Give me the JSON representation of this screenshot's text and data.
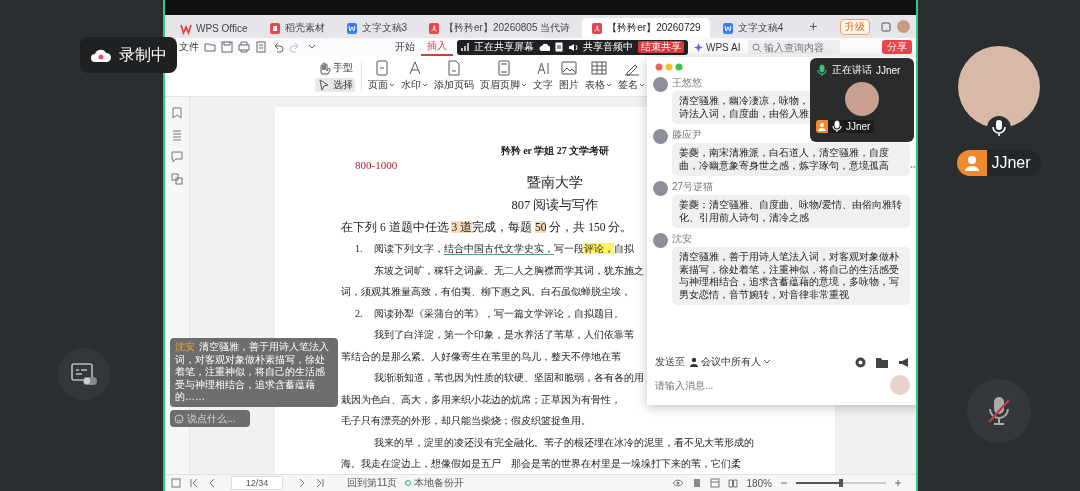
{
  "recording": {
    "label": "录制中"
  },
  "tabs": [
    {
      "label": "WPS Office",
      "kind": "wps",
      "selected": false
    },
    {
      "label": "稻壳素材",
      "kind": "docer",
      "selected": false
    },
    {
      "label": "文字文稿3",
      "kind": "doc",
      "selected": false
    },
    {
      "label": "【矜矜er】20260805 当代诗",
      "kind": "pdf",
      "selected": false
    },
    {
      "label": "【矜矜er】20260729",
      "kind": "pdf",
      "selected": true
    },
    {
      "label": "文字文稿4",
      "kind": "doc",
      "selected": false
    }
  ],
  "title_bar": {
    "new_tab": "+",
    "upgrade": "升级"
  },
  "menu": {
    "file": "文件",
    "ribbon_tabs": [
      {
        "label": "开始",
        "selected": false
      },
      {
        "label": "插入",
        "selected": true
      }
    ],
    "ai": "WPS AI",
    "search": {
      "placeholder": "输入查询内容"
    },
    "share": "分享"
  },
  "share_bar": {
    "status": "正在共享屏幕",
    "audio": "共享音频中",
    "stop": "结束共享"
  },
  "ribbon": [
    {
      "label": "页面",
      "kind": "page",
      "dropdown": true
    },
    {
      "label": "水印",
      "kind": "watermark",
      "dropdown": true
    },
    {
      "label": "添加页码",
      "kind": "page-number",
      "dropdown": false
    },
    {
      "label": "页眉页脚",
      "kind": "header-footer",
      "dropdown": true
    },
    {
      "label": "文字",
      "kind": "text",
      "dropdown": false
    },
    {
      "label": "图片",
      "kind": "image",
      "dropdown": false
    },
    {
      "label": "表格",
      "kind": "table",
      "dropdown": true
    },
    {
      "label": "签名",
      "kind": "signature",
      "dropdown": true
    }
  ],
  "tools": [
    {
      "label": "手型",
      "kind": "hand",
      "selected": false
    },
    {
      "label": "选择",
      "kind": "select",
      "selected": true
    }
  ],
  "document": {
    "header": "矜矜 er 学姐 27 文学考研",
    "range": "800-1000",
    "title": "暨南大学",
    "subtitle": "807 阅读与写作",
    "lines": [
      {
        "kind": "intro",
        "segments": [
          {
            "text": "在下列 6 道题中任选 ",
            "kind": "plain"
          },
          {
            "text": "3 道",
            "kind": "orange"
          },
          {
            "text": "完成，每题 ",
            "kind": "plain"
          },
          {
            "text": "50",
            "kind": "orange"
          },
          {
            "text": " 分，共 150 分。",
            "kind": "plain"
          }
        ]
      },
      {
        "kind": "item",
        "number": "1.",
        "segments": [
          {
            "text": "阅读下列文字，",
            "kind": "plain"
          },
          {
            "text": "结合中国古代文学史实，",
            "kind": "underline"
          },
          {
            "text": "写一段",
            "kind": "plain"
          },
          {
            "text": "评论，",
            "kind": "yellow"
          },
          {
            "text": "自拟",
            "kind": "plain"
          }
        ]
      },
      {
        "kind": "indent",
        "segments": [
          {
            "text": "东坡之词旷，稼轩之词豪。无二人之胸襟而学其词，犹东施之",
            "kind": "plain"
          }
        ]
      },
      {
        "kind": "flush",
        "segments": [
          {
            "text": "词，须观其雅量高致，有伯夷、柳下惠之风。白石虽似蝉脱尘埃，",
            "kind": "plain"
          }
        ]
      },
      {
        "kind": "item",
        "number": "2.",
        "segments": [
          {
            "text": "阅读孙犁《采蒲台的苇》，写一篇文学评论，自拟题目。",
            "kind": "plain"
          }
        ]
      },
      {
        "kind": "indent",
        "segments": [
          {
            "text": "我到了白洋淀，第一个印象，是水养活了苇草，人们依靠苇",
            "kind": "plain"
          }
        ]
      },
      {
        "kind": "flush",
        "segments": [
          {
            "text": "苇结合的是那么紧。人好像寄生在苇里的鸟儿，整天不停地在苇",
            "kind": "plain"
          }
        ]
      },
      {
        "kind": "indent",
        "segments": [
          {
            "text": "我渐渐知道，苇也因为性质的软硬、坚固和脆弱，各有各的用",
            "kind": "plain"
          }
        ]
      },
      {
        "kind": "flush",
        "segments": [
          {
            "text": "栽因为色白、高大，多用来织小花边的炕席；正草因为有骨性，",
            "kind": "plain"
          }
        ]
      },
      {
        "kind": "flush",
        "segments": [
          {
            "text": "毛子只有漂亮的外形，却只能当柴烧；假皮织篮捉鱼用。",
            "kind": "plain"
          }
        ]
      },
      {
        "kind": "indent",
        "segments": [
          {
            "text": "我来的早，淀里的凌还没有完全融化。苇子的根还埋在冰冷的泥里，看不见大苇形成的",
            "kind": "plain"
          }
        ]
      },
      {
        "kind": "flush",
        "segments": [
          {
            "text": "海。我走在淀边上，想像假如是五尸　那会是苇的世界在村里是一垛垛打下来的苇，它们柔",
            "kind": "plain"
          }
        ]
      }
    ]
  },
  "status_bar": {
    "page": "12/34",
    "back": "回到第11页",
    "backup": "本地备份开",
    "zoom": "180%",
    "zoom_slider": {
      "level": 0.5
    }
  },
  "chat": {
    "messages": [
      {
        "sender": "王悠悠",
        "lines": [
          "清空骚雅，幽冷凄凉，咏物，",
          "诗法入词，自度曲，由俗入雅"
        ]
      },
      {
        "sender": "滕应尹",
        "lines": [
          "姜夔，南宋清雅派，白石道人，清空骚雅，自度曲，冷幽意象寄身世之感，炼字琢句，意境孤高"
        ]
      },
      {
        "sender": "27号逆猫",
        "lines": [
          "姜夔：清空骚雅、自度曲、咏物/爱情、由俗向雅转化、引用前人诗句，清冷之感"
        ]
      },
      {
        "sender": "沈安",
        "lines": [
          "清空骚雅，善于用诗人笔法入词，对客观对象做朴素描写，徐处着笔，注重神似，将自己的生活感受与神理相结合，追求含蓄蕴藉的意境，多咏物，写男女恋情，音节婉转，对音律非常重视"
        ]
      }
    ],
    "send_to": "发送至",
    "recipients": "会议中所有人",
    "placeholder": "请输入消息..."
  },
  "speaking_popup": {
    "status": "正在讲话",
    "name": "JJner",
    "footer_name": "JJner"
  },
  "caption": {
    "speaker": "沈安",
    "text": "清空骚雅，善于用诗人笔法入词，对客观对象做朴素描写，徐处着笔，注重神似，将自己的生活感受与神理相结合，追求含蓄蕴藉的……",
    "input_placeholder": "说点什么..."
  },
  "participant": {
    "name": "JJner",
    "muted": false
  },
  "mic_button": {
    "muted": true
  }
}
